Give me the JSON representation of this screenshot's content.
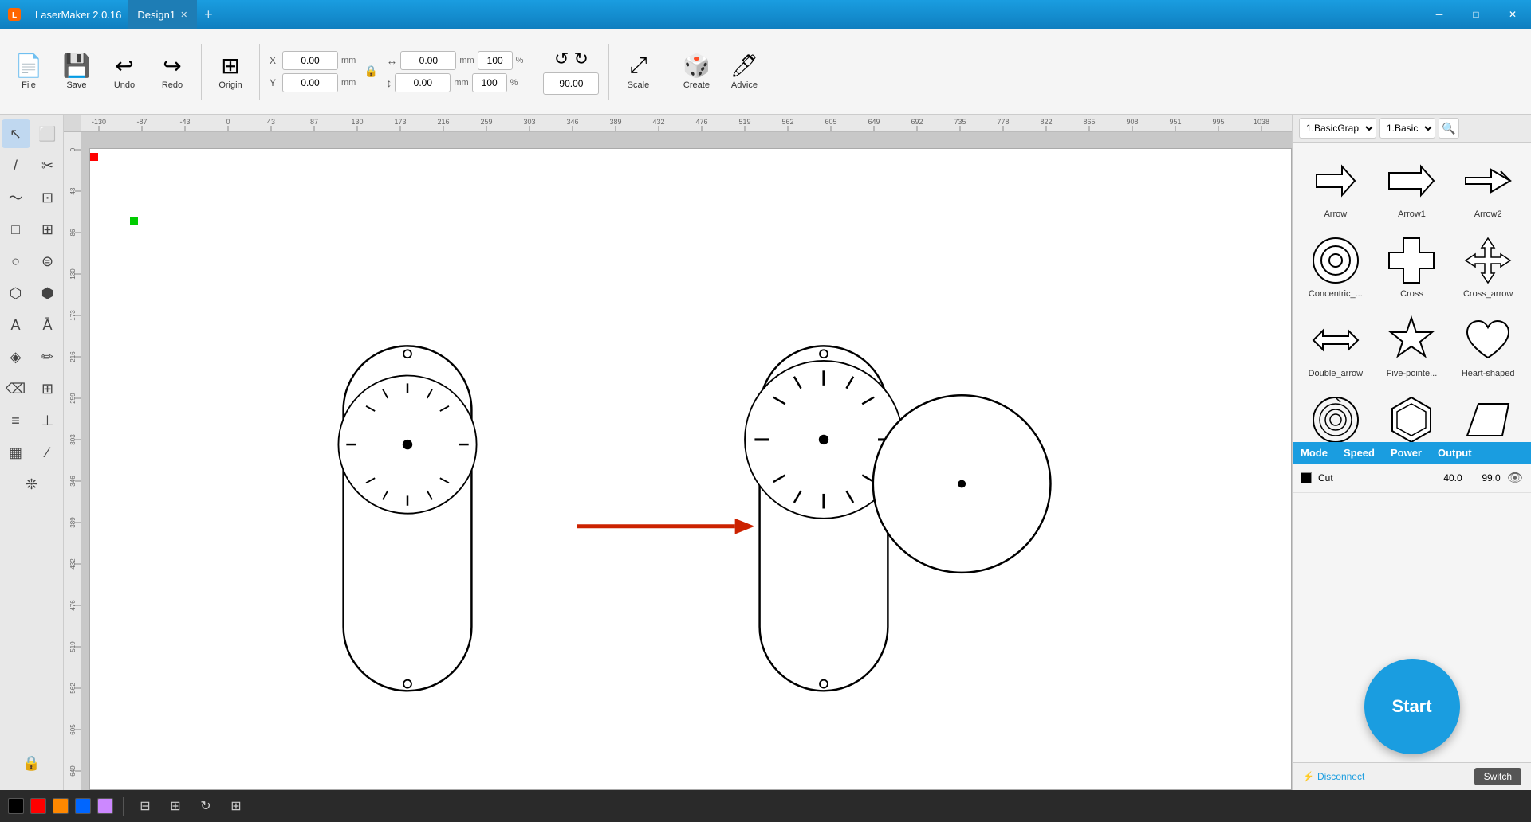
{
  "app": {
    "title": "LaserMaker 2.0.16",
    "tab_name": "Design1",
    "accent_color": "#1a9de0"
  },
  "toolbar": {
    "file_label": "File",
    "save_label": "Save",
    "undo_label": "Undo",
    "redo_label": "Redo",
    "origin_label": "Origin",
    "scale_label": "Scale",
    "create_label": "Create",
    "advice_label": "Advice",
    "x_value": "0.00",
    "y_value": "0.00",
    "w_value": "0.00",
    "h_value": "0.00",
    "w_pct": "100",
    "h_pct": "100",
    "rotate_value": "90.00",
    "mm_label": "mm",
    "pct_label": "%"
  },
  "shapes_panel": {
    "dropdown1_value": "1.BasicGrap",
    "dropdown2_value": "1.Basic",
    "shapes": [
      {
        "id": "arrow",
        "label": "Arrow",
        "type": "arrow"
      },
      {
        "id": "arrow1",
        "label": "Arrow1",
        "type": "arrow1"
      },
      {
        "id": "arrow2",
        "label": "Arrow2",
        "type": "arrow2"
      },
      {
        "id": "concentric",
        "label": "Concentric_...",
        "type": "concentric"
      },
      {
        "id": "cross",
        "label": "Cross",
        "type": "cross"
      },
      {
        "id": "cross_arrow",
        "label": "Cross_arrow",
        "type": "cross_arrow"
      },
      {
        "id": "double_arrow",
        "label": "Double_arrow",
        "type": "double_arrow"
      },
      {
        "id": "five_pointed",
        "label": "Five-pointe...",
        "type": "five_pointed"
      },
      {
        "id": "heart",
        "label": "Heart-shaped",
        "type": "heart"
      },
      {
        "id": "helical",
        "label": "Helical_line",
        "type": "helical"
      },
      {
        "id": "hexagonal",
        "label": "Hexagonal_...",
        "type": "hexagonal"
      },
      {
        "id": "parallelogram",
        "label": "Parallelogram",
        "type": "parallelogram"
      }
    ]
  },
  "layer_panel": {
    "headers": [
      "Mode",
      "Speed",
      "Power",
      "Output"
    ],
    "rows": [
      {
        "color": "#000000",
        "mode": "Cut",
        "speed": "40.0",
        "power": "99.0",
        "visible": true
      }
    ]
  },
  "start_button": "Start",
  "disconnect_label": "Disconnect",
  "switch_label": "Switch",
  "bottom_colors": [
    "#000000",
    "#ff0000",
    "#ff8800",
    "#0066ff",
    "#cc88ff"
  ],
  "bottom_tools": [
    "align",
    "distribute",
    "refresh",
    "grid"
  ]
}
